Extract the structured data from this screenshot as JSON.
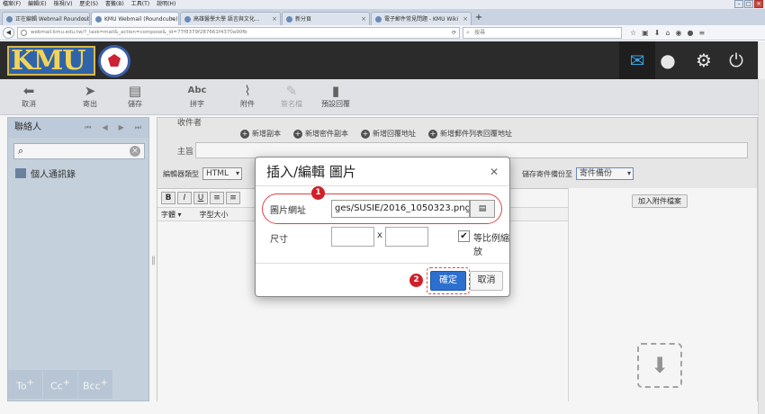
{
  "browser": {
    "menu": [
      "檔案(F)",
      "編輯(E)",
      "檢視(V)",
      "歷史(S)",
      "書籤(B)",
      "工具(T)",
      "說明(H)"
    ],
    "tabs": [
      {
        "label": "正在編輯 Webmail Roundcube M..."
      },
      {
        "label": "KMU Webmail (Roundcube) ..."
      },
      {
        "label": "高雄醫學大學 語言與文化..."
      },
      {
        "label": "新分頁"
      },
      {
        "label": "電子郵件常見問題 - KMU Wiki"
      }
    ],
    "url": "webmail.kmu.edu.tw/?_task=mail&_action=compose&_id=77f8379f287661f4370a90fb",
    "search_placeholder": "搜尋"
  },
  "header": {
    "logo_text": "KMU"
  },
  "toolbar": {
    "cancel": "取消",
    "send": "寄出",
    "save": "儲存",
    "spell": "拼字",
    "spell_icon_text": "Abc",
    "attach": "附件",
    "signature": "簽名檔",
    "response": "預設回覆"
  },
  "sidebar": {
    "title": "聯絡人",
    "address_book": "個人通訊錄",
    "to": "To",
    "cc": "Cc",
    "bcc": "Bcc"
  },
  "compose": {
    "recipient_label": "收件者",
    "add_cc": "新增副本",
    "add_bcc": "新增密件副本",
    "add_reply_to": "新增回覆地址",
    "add_followup": "新增郵件列表回覆地址",
    "subject_label": "主旨",
    "editor_type_label": "編輯器類型",
    "editor_type_value": "HTML",
    "save_copy_label": "儲存寄件備份至",
    "save_copy_value": "寄件備份",
    "font_label": "字體",
    "size_label": "字型大小",
    "attach_button": "加入附件檔案"
  },
  "modal": {
    "title": "插入/編輯 圖片",
    "url_label": "圖片網址",
    "url_value": "ges/SUSIE/2016_1050323.png",
    "size_label": "尺寸",
    "x_sep": "x",
    "constrain_label": "等比例縮放",
    "constrain_checked": true,
    "ok": "確定",
    "cancel": "取消",
    "step1": "1",
    "step2": "2"
  }
}
